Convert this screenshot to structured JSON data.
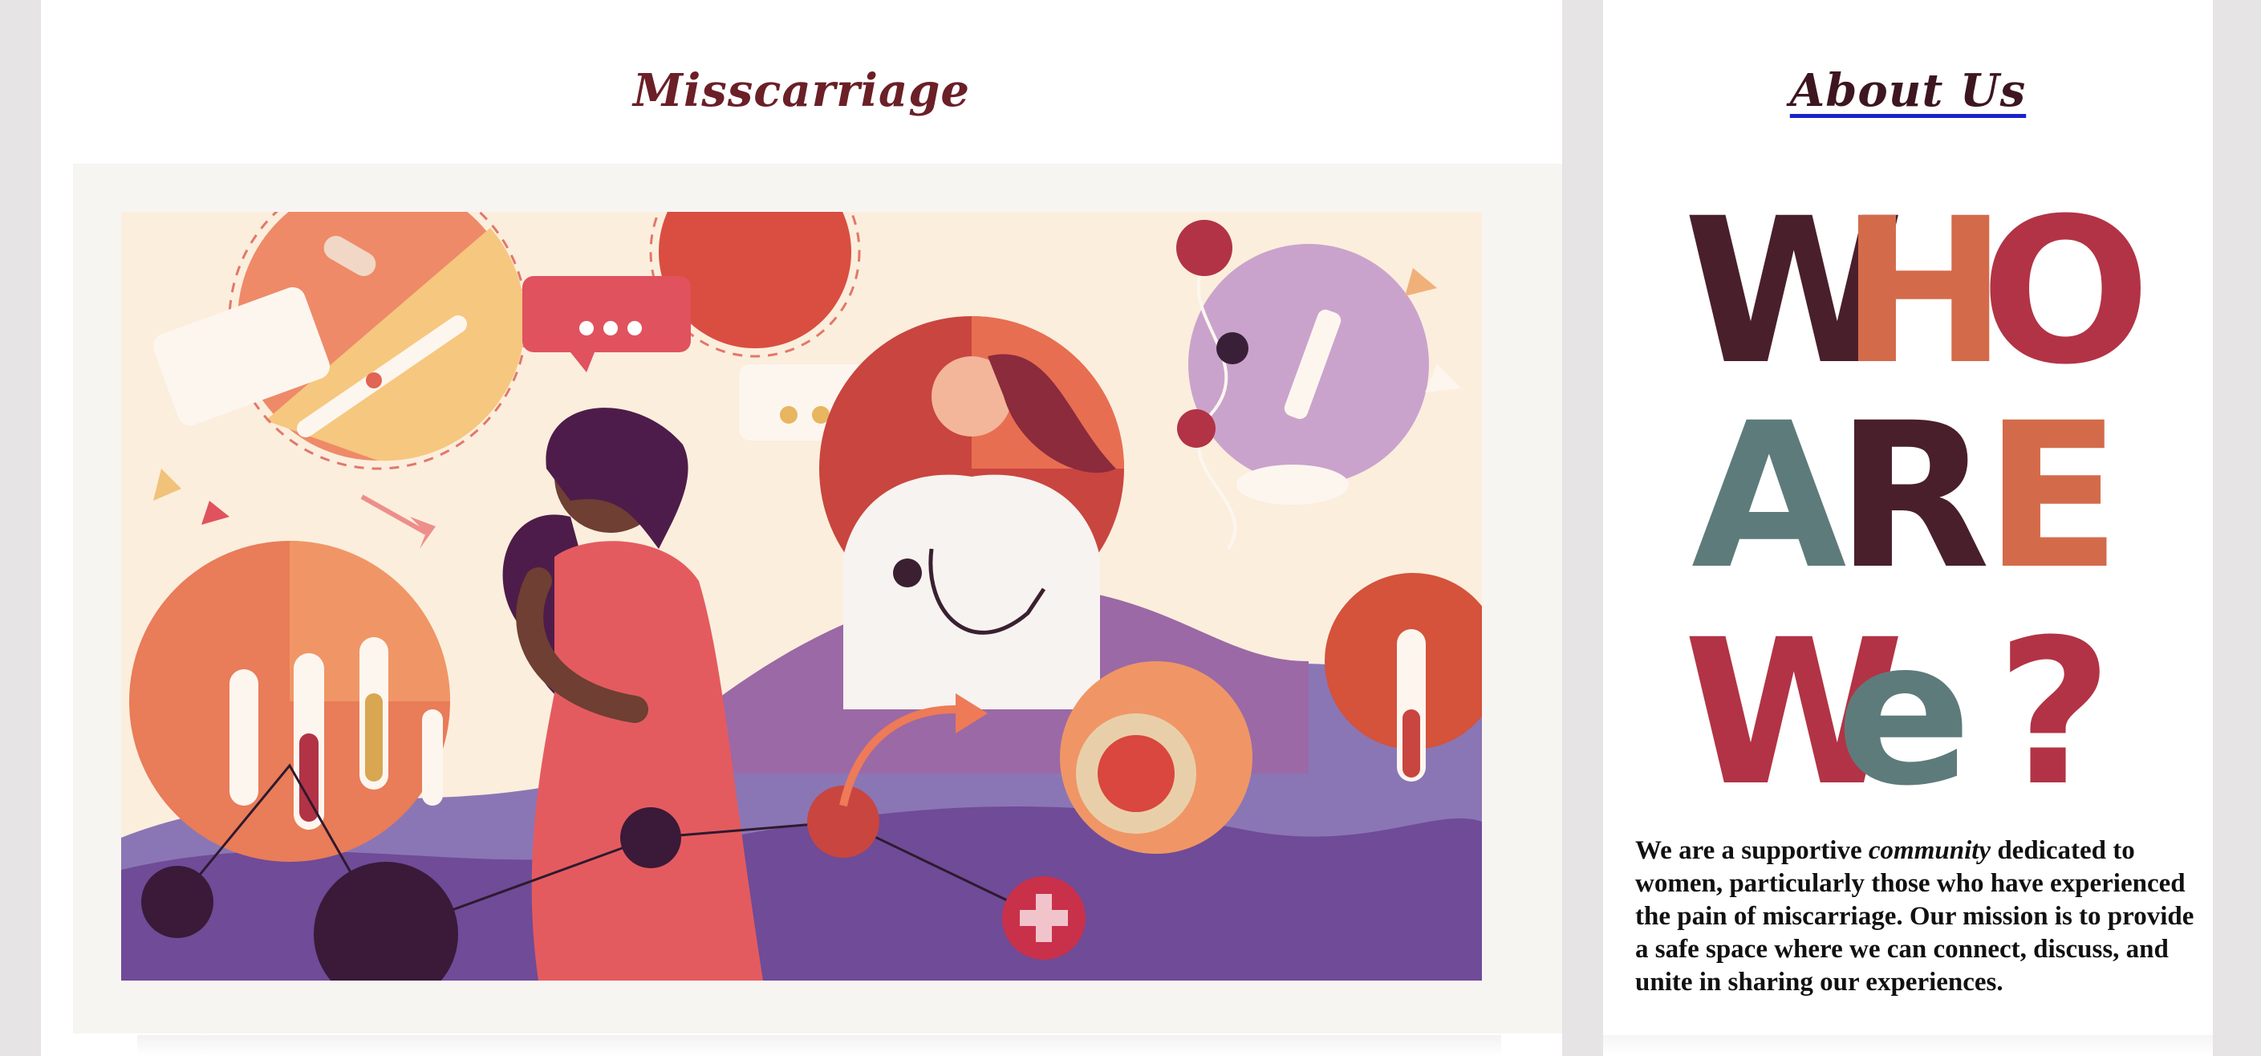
{
  "main": {
    "title": "Misscarriage"
  },
  "sidebar": {
    "title": "About Us",
    "poster_text": "WHO ARE WE?",
    "description_before": "We are a supportive ",
    "description_emphasis": "community",
    "description_after": " dedicated to women, particularly those who have experienced the pain of miscarriage. Our mission is to provide a safe space where we can connect, discuss, and unite in sharing our experiences."
  },
  "colors": {
    "title": "#6b1f27",
    "link_underline": "#1a22cc",
    "poster_maroon": "#4a1f2c",
    "poster_orange": "#d36b4b",
    "poster_red": "#b23345",
    "poster_teal": "#5e7b7b"
  },
  "icons": [
    "chat-bubble-icon",
    "arrow-icon",
    "plus-icon",
    "microscope-icon",
    "dna-icon",
    "syringe-icon",
    "pill-icon",
    "test-tube-icon",
    "stethoscope-icon"
  ]
}
